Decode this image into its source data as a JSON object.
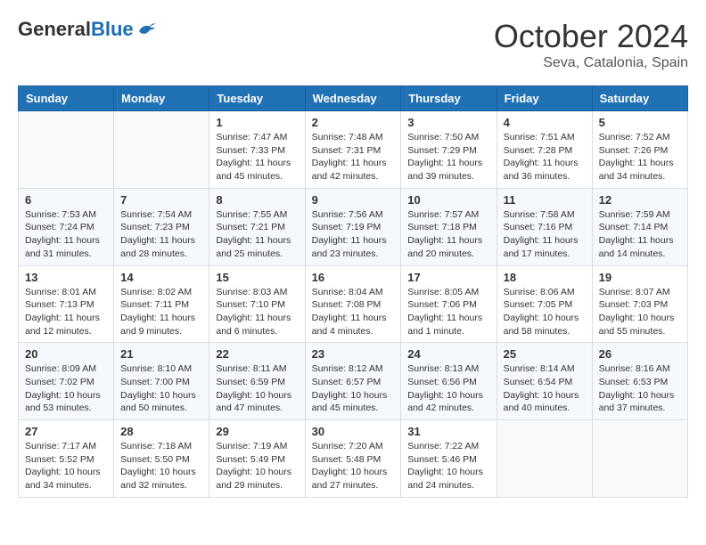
{
  "header": {
    "logo": {
      "general": "General",
      "blue": "Blue"
    },
    "title": "October 2024",
    "subtitle": "Seva, Catalonia, Spain"
  },
  "days_of_week": [
    "Sunday",
    "Monday",
    "Tuesday",
    "Wednesday",
    "Thursday",
    "Friday",
    "Saturday"
  ],
  "weeks": [
    [
      {
        "day": "",
        "info": ""
      },
      {
        "day": "",
        "info": ""
      },
      {
        "day": "1",
        "info": "Sunrise: 7:47 AM\nSunset: 7:33 PM\nDaylight: 11 hours and 45 minutes."
      },
      {
        "day": "2",
        "info": "Sunrise: 7:48 AM\nSunset: 7:31 PM\nDaylight: 11 hours and 42 minutes."
      },
      {
        "day": "3",
        "info": "Sunrise: 7:50 AM\nSunset: 7:29 PM\nDaylight: 11 hours and 39 minutes."
      },
      {
        "day": "4",
        "info": "Sunrise: 7:51 AM\nSunset: 7:28 PM\nDaylight: 11 hours and 36 minutes."
      },
      {
        "day": "5",
        "info": "Sunrise: 7:52 AM\nSunset: 7:26 PM\nDaylight: 11 hours and 34 minutes."
      }
    ],
    [
      {
        "day": "6",
        "info": "Sunrise: 7:53 AM\nSunset: 7:24 PM\nDaylight: 11 hours and 31 minutes."
      },
      {
        "day": "7",
        "info": "Sunrise: 7:54 AM\nSunset: 7:23 PM\nDaylight: 11 hours and 28 minutes."
      },
      {
        "day": "8",
        "info": "Sunrise: 7:55 AM\nSunset: 7:21 PM\nDaylight: 11 hours and 25 minutes."
      },
      {
        "day": "9",
        "info": "Sunrise: 7:56 AM\nSunset: 7:19 PM\nDaylight: 11 hours and 23 minutes."
      },
      {
        "day": "10",
        "info": "Sunrise: 7:57 AM\nSunset: 7:18 PM\nDaylight: 11 hours and 20 minutes."
      },
      {
        "day": "11",
        "info": "Sunrise: 7:58 AM\nSunset: 7:16 PM\nDaylight: 11 hours and 17 minutes."
      },
      {
        "day": "12",
        "info": "Sunrise: 7:59 AM\nSunset: 7:14 PM\nDaylight: 11 hours and 14 minutes."
      }
    ],
    [
      {
        "day": "13",
        "info": "Sunrise: 8:01 AM\nSunset: 7:13 PM\nDaylight: 11 hours and 12 minutes."
      },
      {
        "day": "14",
        "info": "Sunrise: 8:02 AM\nSunset: 7:11 PM\nDaylight: 11 hours and 9 minutes."
      },
      {
        "day": "15",
        "info": "Sunrise: 8:03 AM\nSunset: 7:10 PM\nDaylight: 11 hours and 6 minutes."
      },
      {
        "day": "16",
        "info": "Sunrise: 8:04 AM\nSunset: 7:08 PM\nDaylight: 11 hours and 4 minutes."
      },
      {
        "day": "17",
        "info": "Sunrise: 8:05 AM\nSunset: 7:06 PM\nDaylight: 11 hours and 1 minute."
      },
      {
        "day": "18",
        "info": "Sunrise: 8:06 AM\nSunset: 7:05 PM\nDaylight: 10 hours and 58 minutes."
      },
      {
        "day": "19",
        "info": "Sunrise: 8:07 AM\nSunset: 7:03 PM\nDaylight: 10 hours and 55 minutes."
      }
    ],
    [
      {
        "day": "20",
        "info": "Sunrise: 8:09 AM\nSunset: 7:02 PM\nDaylight: 10 hours and 53 minutes."
      },
      {
        "day": "21",
        "info": "Sunrise: 8:10 AM\nSunset: 7:00 PM\nDaylight: 10 hours and 50 minutes."
      },
      {
        "day": "22",
        "info": "Sunrise: 8:11 AM\nSunset: 6:59 PM\nDaylight: 10 hours and 47 minutes."
      },
      {
        "day": "23",
        "info": "Sunrise: 8:12 AM\nSunset: 6:57 PM\nDaylight: 10 hours and 45 minutes."
      },
      {
        "day": "24",
        "info": "Sunrise: 8:13 AM\nSunset: 6:56 PM\nDaylight: 10 hours and 42 minutes."
      },
      {
        "day": "25",
        "info": "Sunrise: 8:14 AM\nSunset: 6:54 PM\nDaylight: 10 hours and 40 minutes."
      },
      {
        "day": "26",
        "info": "Sunrise: 8:16 AM\nSunset: 6:53 PM\nDaylight: 10 hours and 37 minutes."
      }
    ],
    [
      {
        "day": "27",
        "info": "Sunrise: 7:17 AM\nSunset: 5:52 PM\nDaylight: 10 hours and 34 minutes."
      },
      {
        "day": "28",
        "info": "Sunrise: 7:18 AM\nSunset: 5:50 PM\nDaylight: 10 hours and 32 minutes."
      },
      {
        "day": "29",
        "info": "Sunrise: 7:19 AM\nSunset: 5:49 PM\nDaylight: 10 hours and 29 minutes."
      },
      {
        "day": "30",
        "info": "Sunrise: 7:20 AM\nSunset: 5:48 PM\nDaylight: 10 hours and 27 minutes."
      },
      {
        "day": "31",
        "info": "Sunrise: 7:22 AM\nSunset: 5:46 PM\nDaylight: 10 hours and 24 minutes."
      },
      {
        "day": "",
        "info": ""
      },
      {
        "day": "",
        "info": ""
      }
    ]
  ]
}
